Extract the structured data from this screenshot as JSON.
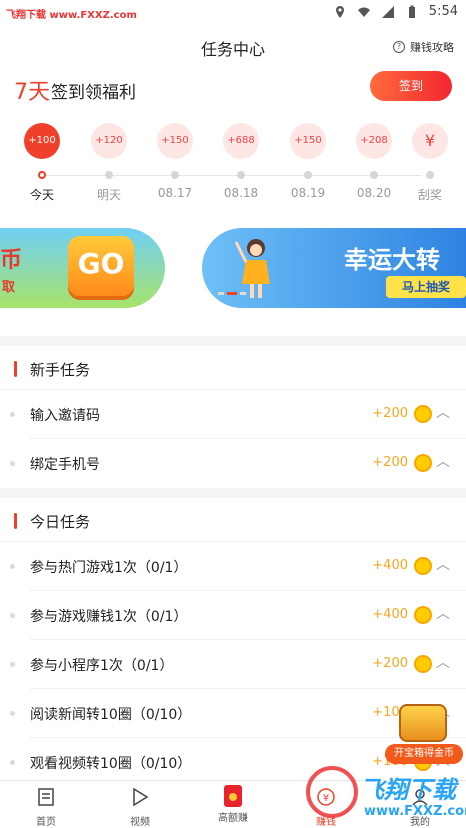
{
  "status_bar": {
    "watermark": "飞翔下载 www.FXXZ.com",
    "time": "5:54",
    "icons": [
      "location-icon",
      "wifi-icon",
      "signal-icon",
      "battery-icon"
    ]
  },
  "header": {
    "title": "任务中心",
    "guide_label": "赚钱攻略"
  },
  "checkin": {
    "days": "7天",
    "text": "签到领福利",
    "button": "签到"
  },
  "rewards": [
    {
      "amount": "+100",
      "label": "今天",
      "active": true
    },
    {
      "amount": "+120",
      "label": "明天"
    },
    {
      "amount": "+150",
      "label": "08.17"
    },
    {
      "amount": "+688",
      "label": "08.18"
    },
    {
      "amount": "+150",
      "label": "08.19"
    },
    {
      "amount": "+208",
      "label": "08.20"
    },
    {
      "amount": "¥",
      "label": "刮奖",
      "gift": true
    }
  ],
  "banner": {
    "left_text_a": "币",
    "left_text_b": "取",
    "go_label": "GO",
    "right_title": "幸运大转",
    "right_button": "马上抽奖"
  },
  "sections": {
    "newbie": {
      "title": "新手任务",
      "tasks": [
        {
          "name": "输入邀请码",
          "points": "+200"
        },
        {
          "name": "绑定手机号",
          "points": "+200"
        }
      ]
    },
    "daily": {
      "title": "今日任务",
      "tasks": [
        {
          "name": "参与热门游戏1次（0/1）",
          "points": "+400"
        },
        {
          "name": "参与游戏赚钱1次（0/1）",
          "points": "+400"
        },
        {
          "name": "参与小程序1次（0/1）",
          "points": "+200"
        },
        {
          "name": "阅读新闻转10圈（0/10）",
          "points": "+100"
        },
        {
          "name": "观看视频转10圈（0/10）",
          "points": "+100"
        }
      ]
    }
  },
  "chest": {
    "label": "开宝箱得金币"
  },
  "nav": [
    {
      "label": "首页",
      "icon": "home-icon"
    },
    {
      "label": "视频",
      "icon": "play-icon"
    },
    {
      "label": "高额赚",
      "icon": "red-packet-icon"
    },
    {
      "label": "赚钱",
      "icon": "money-icon",
      "active": true
    },
    {
      "label": "我的",
      "icon": "user-icon"
    }
  ],
  "watermark": {
    "title": "飞翔下载",
    "url": "www.FXXZ.com"
  },
  "colors": {
    "accent": "#f0402b",
    "points": "#f5a623",
    "banner_blue": "#2a7fe0"
  }
}
